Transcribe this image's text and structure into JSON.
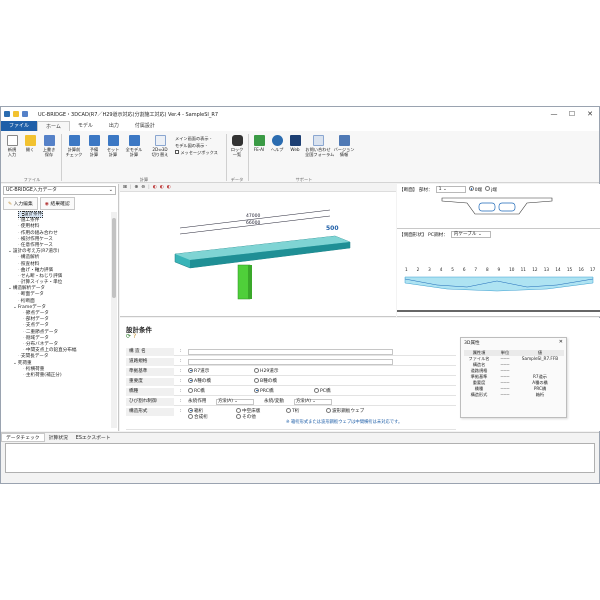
{
  "app": {
    "title": "UC-BRIDGE・3DCAD(R7／H29道示対応(分割施工対応) Ver.4 - SampleSI_R7",
    "window_controls": [
      "—",
      "☐",
      "✕"
    ]
  },
  "menu": {
    "tabs": [
      "ファイル",
      "ホーム",
      "モデル",
      "出力",
      "付属設計"
    ],
    "active": "ファイル"
  },
  "ribbon": {
    "file": {
      "buttons": [
        "新規\n入力",
        "開く",
        "上書き\n保存"
      ],
      "group_label": "ファイル"
    },
    "calc": {
      "buttons": [
        "計算前\nチェック",
        "予備\n計算",
        "セット\n計算",
        "全モデル\n計算",
        "2D⇔3D\n切り替え"
      ],
      "group_label": "計算"
    },
    "display": {
      "items": [
        "メイン画面の表示 -",
        "モデル図の表示 -",
        "メッセージボックス"
      ]
    },
    "fe_label": "データ\n一覧",
    "lock_label": "ロック\n一覧",
    "support": {
      "buttons": [
        "FE-AI",
        "ヘルプ",
        "Web",
        "お問い合わせ\n全国フォーラム",
        "バージョン\n情報"
      ],
      "group_label": "サポート"
    },
    "data_group_label": "データ"
  },
  "left": {
    "combo": "UC-BRIDGE入力データ",
    "tabs": [
      "入力編集",
      "結果確認"
    ],
    "tree": [
      {
        "label": "設計条件",
        "indent": 3,
        "selected": true
      },
      {
        "label": "施工条件",
        "indent": 3
      },
      {
        "label": "使用材料",
        "indent": 3
      },
      {
        "label": "作用の組み合わせ",
        "indent": 3
      },
      {
        "label": "検討作用ケース",
        "indent": 3
      },
      {
        "label": "任意作用ケース",
        "indent": 3
      },
      {
        "label": "設計の考え方(R7道示)",
        "indent": 1,
        "toggle": "⌄"
      },
      {
        "label": "構造解析",
        "indent": 3
      },
      {
        "label": "照査材料",
        "indent": 3
      },
      {
        "label": "曲げ・軸力評価",
        "indent": 3
      },
      {
        "label": "せん断・ねじり評価",
        "indent": 3
      },
      {
        "label": "計算スイッチ・単位",
        "indent": 3
      },
      {
        "label": "構造解析データ",
        "indent": 1,
        "toggle": "⌄"
      },
      {
        "label": "断面データ",
        "indent": 3
      },
      {
        "label": "桁断面",
        "indent": 3
      },
      {
        "label": "Frameデータ",
        "indent": 2,
        "toggle": "⌄"
      },
      {
        "label": "節点データ",
        "indent": 4
      },
      {
        "label": "部材データ",
        "indent": 4
      },
      {
        "label": "支点データ",
        "indent": 4
      },
      {
        "label": "二重節点データ",
        "indent": 4
      },
      {
        "label": "剛域データ",
        "indent": 4
      },
      {
        "label": "分布バネデータ",
        "indent": 4
      },
      {
        "label": "中間支点上の鉛直分布幅",
        "indent": 4
      },
      {
        "label": "支間長データ",
        "indent": 3
      },
      {
        "label": "死荷重",
        "indent": 2,
        "toggle": "⌄"
      },
      {
        "label": "桁横荷重",
        "indent": 4
      },
      {
        "label": "主桁荷重(補正分)",
        "indent": 4
      }
    ]
  },
  "view3d": {
    "toolbar": [
      "⊞",
      "|",
      "⊕",
      "⊖",
      "|",
      "◐",
      "◐",
      "◐"
    ],
    "dims": [
      "47000",
      "66000",
      "500"
    ]
  },
  "section_panel": {
    "label": "【断面】 部材：",
    "member": "1",
    "options": [
      "0端",
      "j端"
    ],
    "selected": "0端"
  },
  "side_panel": {
    "label": "【側面形状】 PC鋼材：",
    "value": "内ケーブル",
    "nodes": [
      "1",
      "2",
      "3",
      "4",
      "5",
      "6",
      "7",
      "8",
      "9",
      "10",
      "11",
      "12",
      "13",
      "14",
      "15",
      "16",
      "17"
    ]
  },
  "form": {
    "title": "設計条件",
    "rows": {
      "bridge_name": {
        "label": "構 造 名",
        "value": ""
      },
      "road_spec": {
        "label": "道路規格",
        "value": ""
      },
      "std": {
        "label": "準拠基準",
        "opts": [
          "R7道示",
          "H29道示"
        ],
        "sel": 0
      },
      "importance": {
        "label": "重要度",
        "opts": [
          "A種の橋",
          "B種の橋"
        ],
        "sel": 0
      },
      "bridge_type": {
        "label": "橋種",
        "opts": [
          "RC橋",
          "PRC橋",
          "PC橋"
        ],
        "sel": 1
      },
      "crack": {
        "label": "ひび割れ制御",
        "a": "永続作用",
        "a_val": "方法(A)",
        "b": "永続/変動",
        "b_val": "方法(A)"
      },
      "structure": {
        "label": "構造形式",
        "opts": [
          "箱桁",
          "中空床版",
          "T桁",
          "合成桁",
          "その他",
          "波形鋼板ウェブ"
        ],
        "sel": 0
      }
    },
    "note": "※ 箱桁形式または波形鋼板ウェブは中間横桁は未対応です。"
  },
  "info_popup": {
    "title": "3D属性",
    "close": "✕",
    "headers": [
      "属性項",
      "単位",
      "値"
    ],
    "rows": [
      [
        "ファイル名",
        "------",
        "SampleSI_R7.FFB"
      ],
      [
        "構造名",
        "------",
        ""
      ],
      [
        "道路規格",
        "------",
        ""
      ],
      [
        "準拠基準",
        "------",
        "R7道示"
      ],
      [
        "重要度",
        "------",
        "A種の橋"
      ],
      [
        "橋種",
        "------",
        "PRC橋"
      ],
      [
        "構造形式",
        "------",
        "箱桁"
      ]
    ]
  },
  "bottom_tabs": [
    "データチェック",
    "計算状況",
    "ESエクスポート"
  ]
}
